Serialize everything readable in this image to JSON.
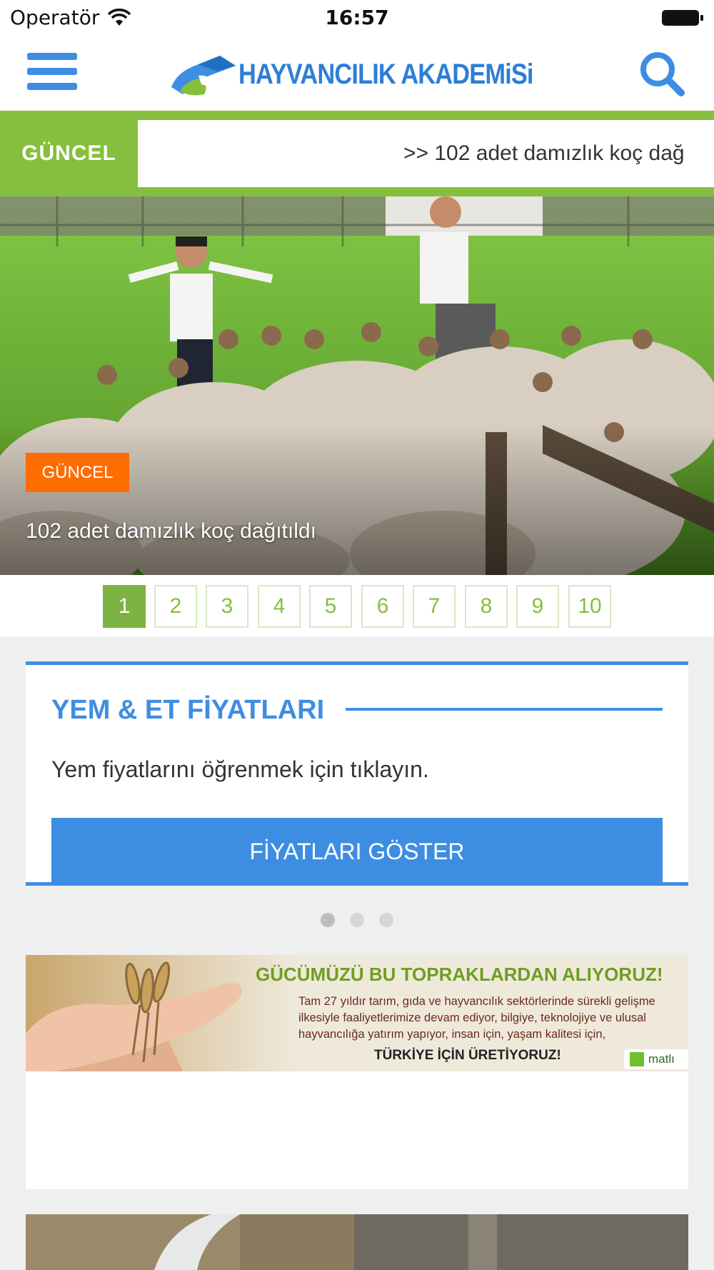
{
  "status_bar": {
    "carrier": "Operatör",
    "time": "16:57"
  },
  "header": {
    "logo_text": "HAYVANCILIK AKADEMiSi"
  },
  "ticker": {
    "label": "GÜNCEL",
    "text": ">> 102 adet damızlık koç dağ"
  },
  "hero": {
    "badge": "GÜNCEL",
    "caption": "102 adet damızlık koç dağıtıldı"
  },
  "pager": {
    "pages": [
      "1",
      "2",
      "3",
      "4",
      "5",
      "6",
      "7",
      "8",
      "9",
      "10"
    ],
    "active_index": 0
  },
  "price_card": {
    "title": "YEM & ET FİYATLARI",
    "description": "Yem fiyatlarını öğrenmek için tıklayın.",
    "button_label": "FİYATLARI GÖSTER"
  },
  "carousel_dots": {
    "count": 3,
    "active_index": 0
  },
  "ad": {
    "headline": "GÜCÜMÜZÜ BU TOPRAKLARDAN ALIYORUZ!",
    "body": "Tam 27 yıldır tarım, gıda ve hayvancılık sektörlerinde sürekli gelişme ilkesiyle faaliyetlerimize devam ediyor, bilgiye, teknolojiye ve ulusal hayvancılığa yatırım yapıyor, insan için, yaşam kalitesi için,",
    "tagline": "TÜRKİYE İÇİN ÜRETİYORUZ!",
    "brand": "matlı"
  },
  "colors": {
    "accent_blue": "#3d8ee3",
    "accent_green": "#86bf3d",
    "badge_orange": "#ff6c00"
  },
  "icons": [
    "hamburger-menu-icon",
    "search-icon",
    "wifi-icon",
    "battery-icon"
  ]
}
